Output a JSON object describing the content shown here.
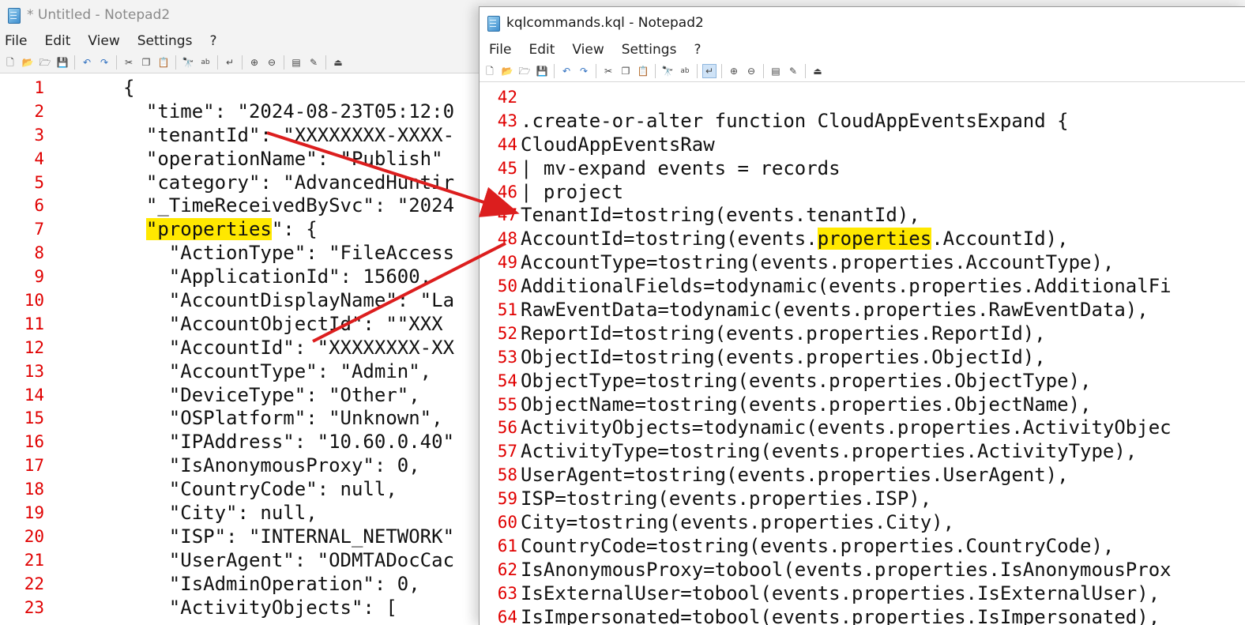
{
  "left_window": {
    "title": "* Untitled - Notepad2",
    "menu": [
      "File",
      "Edit",
      "View",
      "Settings",
      "?"
    ],
    "lines": [
      {
        "n": "1",
        "pre": "{",
        "hl": "",
        "post": ""
      },
      {
        "n": "2",
        "pre": "  \"time\": \"2024-08-23T05:12:0",
        "hl": "",
        "post": ""
      },
      {
        "n": "3",
        "pre": "  \"tenantId\": \"XXXXXXXX-XXXX-",
        "hl": "",
        "post": ""
      },
      {
        "n": "4",
        "pre": "  \"operationName\": \"Publish\"",
        "hl": "",
        "post": ""
      },
      {
        "n": "5",
        "pre": "  \"category\": \"AdvancedHuntir",
        "hl": "",
        "post": ""
      },
      {
        "n": "6",
        "pre": "  \"_TimeReceivedBySvc\": \"2024",
        "hl": "",
        "post": ""
      },
      {
        "n": "7",
        "pre": "  ",
        "hl": "\"properties",
        "post": "\": {"
      },
      {
        "n": "8",
        "pre": "    \"ActionType\": \"FileAccess",
        "hl": "",
        "post": ""
      },
      {
        "n": "9",
        "pre": "    \"ApplicationId\": 15600,",
        "hl": "",
        "post": ""
      },
      {
        "n": "10",
        "pre": "    \"AccountDisplayName\": \"La",
        "hl": "",
        "post": ""
      },
      {
        "n": "11",
        "pre": "    \"AccountObjectId\": \"\"XXX",
        "hl": "",
        "post": ""
      },
      {
        "n": "12",
        "pre": "    \"AccountId\": \"XXXXXXXX-XX",
        "hl": "",
        "post": ""
      },
      {
        "n": "13",
        "pre": "    \"AccountType\": \"Admin\",",
        "hl": "",
        "post": ""
      },
      {
        "n": "14",
        "pre": "    \"DeviceType\": \"Other\",",
        "hl": "",
        "post": ""
      },
      {
        "n": "15",
        "pre": "    \"OSPlatform\": \"Unknown\",",
        "hl": "",
        "post": ""
      },
      {
        "n": "16",
        "pre": "    \"IPAddress\": \"10.60.0.40\"",
        "hl": "",
        "post": ""
      },
      {
        "n": "17",
        "pre": "    \"IsAnonymousProxy\": 0,",
        "hl": "",
        "post": ""
      },
      {
        "n": "18",
        "pre": "    \"CountryCode\": null,",
        "hl": "",
        "post": ""
      },
      {
        "n": "19",
        "pre": "    \"City\": null,",
        "hl": "",
        "post": ""
      },
      {
        "n": "20",
        "pre": "    \"ISP\": \"INTERNAL_NETWORK\"",
        "hl": "",
        "post": ""
      },
      {
        "n": "21",
        "pre": "    \"UserAgent\": \"ODMTADocCac",
        "hl": "",
        "post": ""
      },
      {
        "n": "22",
        "pre": "    \"IsAdminOperation\": 0,",
        "hl": "",
        "post": ""
      },
      {
        "n": "23",
        "pre": "    \"ActivityObjects\": [",
        "hl": "",
        "post": ""
      }
    ]
  },
  "right_window": {
    "title": "kqlcommands.kql - Notepad2",
    "menu": [
      "File",
      "Edit",
      "View",
      "Settings",
      "?"
    ],
    "lines": [
      {
        "n": "42",
        "pre": "",
        "hl": "",
        "post": ""
      },
      {
        "n": "43",
        "pre": ".create-or-alter function CloudAppEventsExpand {",
        "hl": "",
        "post": ""
      },
      {
        "n": "44",
        "pre": "CloudAppEventsRaw",
        "hl": "",
        "post": ""
      },
      {
        "n": "45",
        "pre": "| mv-expand events = records",
        "hl": "",
        "post": ""
      },
      {
        "n": "46",
        "pre": "| project",
        "hl": "",
        "post": ""
      },
      {
        "n": "47",
        "pre": "TenantId=tostring(events.tenantId),",
        "hl": "",
        "post": ""
      },
      {
        "n": "48",
        "pre": "AccountId=tostring(events.",
        "hl": "properties",
        "post": ".AccountId),"
      },
      {
        "n": "49",
        "pre": "AccountType=tostring(events.properties.AccountType),",
        "hl": "",
        "post": ""
      },
      {
        "n": "50",
        "pre": "AdditionalFields=todynamic(events.properties.AdditionalFi",
        "hl": "",
        "post": ""
      },
      {
        "n": "51",
        "pre": "RawEventData=todynamic(events.properties.RawEventData),",
        "hl": "",
        "post": ""
      },
      {
        "n": "52",
        "pre": "ReportId=tostring(events.properties.ReportId),",
        "hl": "",
        "post": ""
      },
      {
        "n": "53",
        "pre": "ObjectId=tostring(events.properties.ObjectId),",
        "hl": "",
        "post": ""
      },
      {
        "n": "54",
        "pre": "ObjectType=tostring(events.properties.ObjectType),",
        "hl": "",
        "post": ""
      },
      {
        "n": "55",
        "pre": "ObjectName=tostring(events.properties.ObjectName),",
        "hl": "",
        "post": ""
      },
      {
        "n": "56",
        "pre": "ActivityObjects=todynamic(events.properties.ActivityObjec",
        "hl": "",
        "post": ""
      },
      {
        "n": "57",
        "pre": "ActivityType=tostring(events.properties.ActivityType),",
        "hl": "",
        "post": ""
      },
      {
        "n": "58",
        "pre": "UserAgent=tostring(events.properties.UserAgent),",
        "hl": "",
        "post": ""
      },
      {
        "n": "59",
        "pre": "ISP=tostring(events.properties.ISP),",
        "hl": "",
        "post": ""
      },
      {
        "n": "60",
        "pre": "City=tostring(events.properties.City),",
        "hl": "",
        "post": ""
      },
      {
        "n": "61",
        "pre": "CountryCode=tostring(events.properties.CountryCode),",
        "hl": "",
        "post": ""
      },
      {
        "n": "62",
        "pre": "IsAnonymousProxy=tobool(events.properties.IsAnonymousProx",
        "hl": "",
        "post": ""
      },
      {
        "n": "63",
        "pre": "IsExternalUser=tobool(events.properties.IsExternalUser),",
        "hl": "",
        "post": ""
      },
      {
        "n": "64",
        "pre": "IsImpersonated=tobool(events.properties.IsImpersonated),",
        "hl": "",
        "post": ""
      }
    ]
  },
  "toolbar_icons": [
    "new-icon",
    "open-icon",
    "browse-icon",
    "save-icon",
    "undo-icon",
    "redo-icon",
    "cut-icon",
    "copy-icon",
    "paste-icon",
    "find-icon",
    "replace-icon",
    "word-wrap-icon",
    "zoom-in-icon",
    "zoom-out-icon",
    "settings-icon",
    "scheme-icon",
    "exit-icon"
  ],
  "colors": {
    "line_numbers": "#e00000",
    "highlight": "#ffe800",
    "annotation_arrow": "#dc1e1e"
  }
}
